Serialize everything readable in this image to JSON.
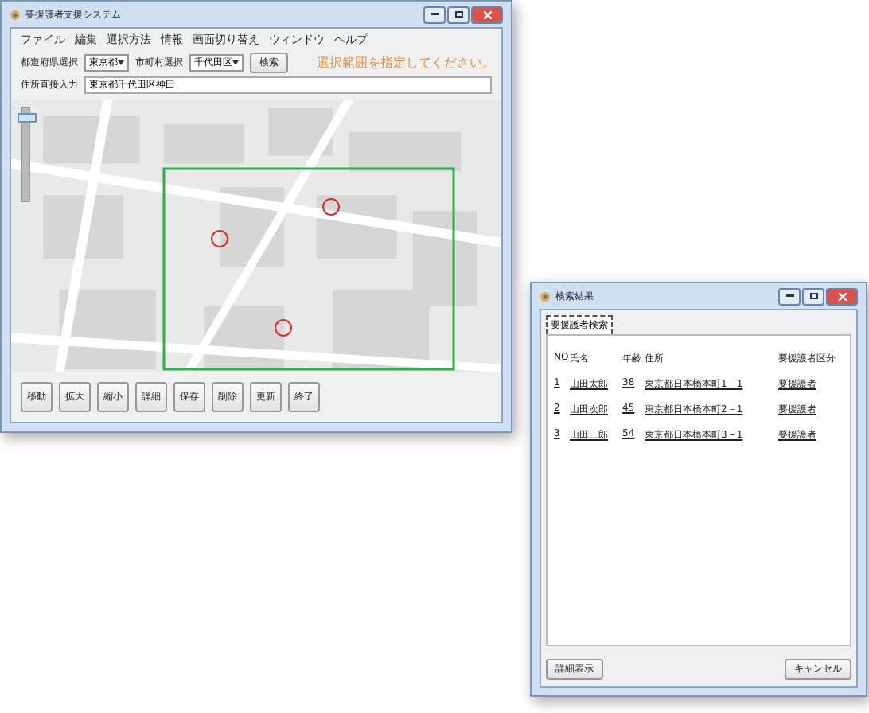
{
  "main_window": {
    "title": "要援護者支援システム"
  },
  "menu": [
    "ファイル",
    "編集",
    "選択方法",
    "情報",
    "画面切り替え",
    "ウィンドウ",
    "ヘルプ"
  ],
  "filters": {
    "prefecture_label": "都道府県選択",
    "prefecture": "東京都",
    "city_label": "市町村選択",
    "city": "千代田区",
    "search_button": "検索",
    "hint": "選択範囲を指定してください。"
  },
  "address": {
    "label": "住所直接入力",
    "value": "東京都千代田区神田"
  },
  "map": {
    "zoom": {
      "level": 0.95
    }
  },
  "toolbar_buttons": [
    "移動",
    "拡大",
    "縮小",
    "詳細",
    "保存",
    "削除",
    "更新",
    "終了"
  ],
  "dialog": {
    "title": "検索結果",
    "tabs": [
      {
        "label": "要援護者検索",
        "selected": true
      }
    ],
    "columns": [
      "NO",
      "氏名",
      "年齢",
      "住所",
      "要援護者区分"
    ],
    "rows": [
      [
        "1",
        "山田太郎",
        "38",
        "東京都日本橋本町1－1",
        "要援護者"
      ],
      [
        "2",
        "山田次郎",
        "45",
        "東京都日本橋本町2－1",
        "要援護者"
      ],
      [
        "3",
        "山田三郎",
        "54",
        "東京都日本橋本町3－1",
        "要援護者"
      ]
    ],
    "buttons": [
      "詳細表示",
      "キャンセル"
    ]
  }
}
